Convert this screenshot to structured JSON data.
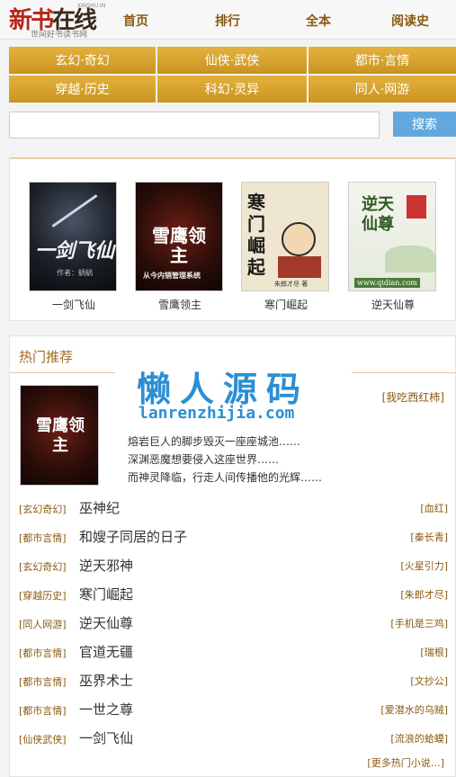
{
  "logo": {
    "main_a": "新书",
    "main_b": "在线",
    "en": "XINSHU.IN",
    "slogan": "世间好书读书网"
  },
  "nav": [
    "首页",
    "排行",
    "全本",
    "阅读史"
  ],
  "categories": [
    "玄幻·奇幻",
    "仙侠·武侠",
    "都市·言情",
    "穿越·历史",
    "科幻·灵异",
    "同人·网游"
  ],
  "search": {
    "placeholder": "",
    "button": "搜索"
  },
  "featured": [
    {
      "title": "一剑飞仙",
      "cover_text": "一剑飞仙",
      "cover_author": "作者：蜗蜗"
    },
    {
      "title": "雪鹰领主",
      "cover_text": "雪鹰领主",
      "cover_sub": "从今内销管理系统"
    },
    {
      "title": "寒门崛起",
      "cover_text": "寒门崛起",
      "cover_sub": "朱郎才尽 著"
    },
    {
      "title": "逆天仙尊",
      "cover_text": "逆天仙尊",
      "cover_sub": "www.qidian.com"
    }
  ],
  "hot": {
    "title": "热门推荐",
    "watermark_cn": "懒人源码",
    "watermark_en": "lanrenzhijia.com",
    "top": {
      "cover_text": "雪鹰领主",
      "author": "[我吃西红柿]",
      "desc": [
        "熔岩巨人的脚步毁灭一座座城池……",
        "深渊恶魔想要侵入这座世界……",
        "而神灵降临，行走人间传播他的光辉……"
      ]
    },
    "list": [
      {
        "tag": "[玄幻奇幻]",
        "name": "巫神纪",
        "author": "[血红]"
      },
      {
        "tag": "[都市言情]",
        "name": "和嫂子同居的日子",
        "author": "[秦长青]"
      },
      {
        "tag": "[玄幻奇幻]",
        "name": "逆天邪神",
        "author": "[火星引力]"
      },
      {
        "tag": "[穿越历史]",
        "name": "寒门崛起",
        "author": "[朱郎才尽]"
      },
      {
        "tag": "[同人网游]",
        "name": "逆天仙尊",
        "author": "[手机是三鸡]"
      },
      {
        "tag": "[都市言情]",
        "name": "官道无疆",
        "author": "[瑞根]"
      },
      {
        "tag": "[都市言情]",
        "name": "巫界术士",
        "author": "[文抄公]"
      },
      {
        "tag": "[都市言情]",
        "name": "一世之尊",
        "author": "[爱潜水的乌贼]"
      },
      {
        "tag": "[仙侠武侠]",
        "name": "一剑飞仙",
        "author": "[流浪的蛤蟆]"
      }
    ],
    "more": "[更多热门小说…]"
  }
}
